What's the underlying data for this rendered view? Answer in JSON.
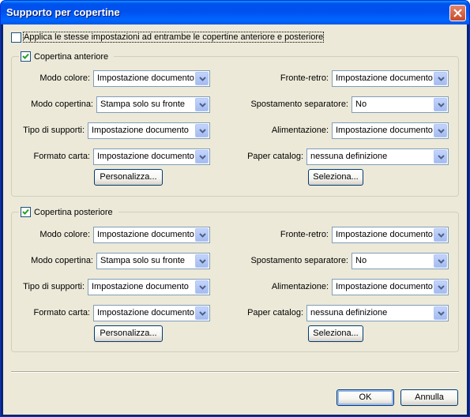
{
  "window": {
    "title": "Supporto per copertine",
    "close_icon": "close-icon"
  },
  "apply_both": {
    "label": "Applica le stesse impostazioni ad entrambe le copertine anteriore e posteriore",
    "checked": false
  },
  "front": {
    "title": "Copertina anteriore",
    "checked": true,
    "modo_colore_label": "Modo colore:",
    "modo_colore_value": "Impostazione documento",
    "modo_copertina_label": "Modo copertina:",
    "modo_copertina_value": "Stampa solo su fronte",
    "tipo_supporti_label": "Tipo di supporti:",
    "tipo_supporti_value": "Impostazione documento",
    "formato_carta_label": "Formato carta:",
    "formato_carta_value": "Impostazione documento",
    "personalizza_label": "Personalizza...",
    "fronte_retro_label": "Fronte-retro:",
    "fronte_retro_value": "Impostazione documento",
    "spostamento_label": "Spostamento separatore:",
    "spostamento_value": "No",
    "alimentazione_label": "Alimentazione:",
    "alimentazione_value": "Impostazione documento",
    "paper_catalog_label": "Paper catalog:",
    "paper_catalog_value": "nessuna definizione",
    "seleziona_label": "Seleziona..."
  },
  "back": {
    "title": "Copertina posteriore",
    "checked": true,
    "modo_colore_label": "Modo colore:",
    "modo_colore_value": "Impostazione documento",
    "modo_copertina_label": "Modo copertina:",
    "modo_copertina_value": "Stampa solo su fronte",
    "tipo_supporti_label": "Tipo di supporti:",
    "tipo_supporti_value": "Impostazione documento",
    "formato_carta_label": "Formato carta:",
    "formato_carta_value": "Impostazione documento",
    "personalizza_label": "Personalizza...",
    "fronte_retro_label": "Fronte-retro:",
    "fronte_retro_value": "Impostazione documento",
    "spostamento_label": "Spostamento separatore:",
    "spostamento_value": "No",
    "alimentazione_label": "Alimentazione:",
    "alimentazione_value": "Impostazione documento",
    "paper_catalog_label": "Paper catalog:",
    "paper_catalog_value": "nessuna definizione",
    "seleziona_label": "Seleziona..."
  },
  "footer": {
    "ok_label": "OK",
    "cancel_label": "Annulla"
  },
  "colors": {
    "title_bar": "#0054e3",
    "dialog_bg": "#ece9d8",
    "close_button": "#c84a2b",
    "check": "#21a121"
  }
}
